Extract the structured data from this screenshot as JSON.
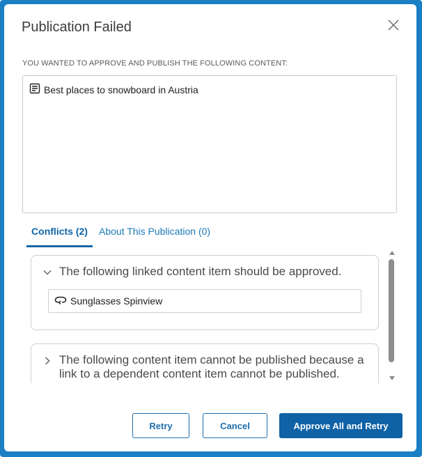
{
  "dialog": {
    "title": "Publication Failed",
    "close_icon": "close-x-icon",
    "subhead": "YOU WANTED TO APPROVE AND PUBLISH THE FOLLOWING CONTENT:",
    "content_items": [
      {
        "icon": "document-icon",
        "label": "Best places to snowboard in Austria"
      }
    ]
  },
  "tabs": [
    {
      "label": "Conflicts (2)",
      "active": true
    },
    {
      "label": "About This Publication (0)",
      "active": false
    }
  ],
  "conflicts": [
    {
      "expanded": true,
      "icon": "chevron-down-icon",
      "title": "The following linked content item should be approved.",
      "items": [
        {
          "icon": "link-icon",
          "label": "Sunglasses Spinview"
        }
      ]
    },
    {
      "expanded": false,
      "icon": "chevron-right-icon",
      "title": "The following content item cannot be published because a link to a dependent content item cannot be published."
    }
  ],
  "buttons": {
    "retry": "Retry",
    "cancel": "Cancel",
    "approve_all": "Approve All and Retry"
  },
  "colors": {
    "accent": "#0f62a6",
    "frame": "#1b7fc4",
    "tab_active": "#0f66a8"
  }
}
